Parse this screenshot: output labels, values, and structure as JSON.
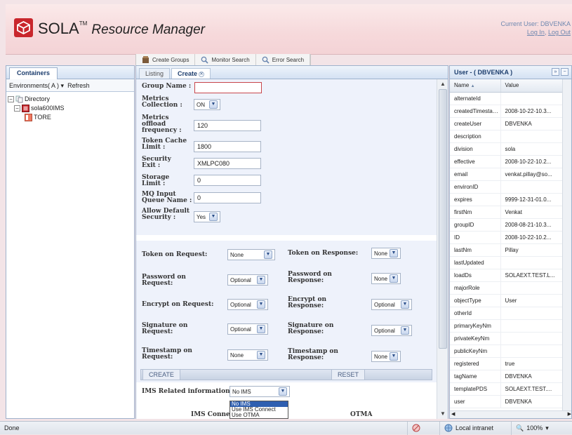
{
  "header": {
    "brand": "SOLA",
    "trademark": "TM",
    "subtitle": "Resource Manager",
    "current_user": "Current User: DBVENKA",
    "login_link": "Log In",
    "logout_link": "Log Out",
    "links_separator": ","
  },
  "toolbar": {
    "create_groups": "Create Groups",
    "monitor_search": "Monitor Search",
    "error_search": "Error Search"
  },
  "containers": {
    "tab": "Containers",
    "environments": "Environments( A ) ",
    "environments_caret": "▾",
    "refresh": "Refresh",
    "tree": {
      "directory": "Directory",
      "server": "sola600IMS",
      "leaf": "TORE"
    }
  },
  "center": {
    "tab_listing": "Listing",
    "tab_create": "Create",
    "fields": {
      "group_name": {
        "label": "Group Name :",
        "value": ""
      },
      "metrics_collection": {
        "label": "Metrics Collection :",
        "value": "ON"
      },
      "metrics_offload": {
        "label": "Metrics offload frequency :",
        "value": "120"
      },
      "token_cache": {
        "label": "Token Cache Limit :",
        "value": "1800"
      },
      "security_exit": {
        "label": "Security Exit :",
        "value": "XMLPC080"
      },
      "storage_limit": {
        "label": "Storage Limit :",
        "value": "0"
      },
      "mq_input": {
        "label": "MQ Input Queue Name :",
        "value": "0"
      },
      "allow_default": {
        "label": "Allow Default Security :",
        "value": "Yes"
      }
    },
    "security": {
      "token_request": {
        "label": "Token on Request:",
        "value": "None"
      },
      "token_response": {
        "label": "Token on Response:",
        "value": "None"
      },
      "password_request": {
        "label": "Password on Request:",
        "value": "Optional"
      },
      "password_response": {
        "label": "Password on Response:",
        "value": "None"
      },
      "encrypt_request": {
        "label": "Encrypt on Request:",
        "value": "Optional"
      },
      "encrypt_response": {
        "label": "Encrypt on Response:",
        "value": "Optional"
      },
      "signature_request": {
        "label": "Signature on Request:",
        "value": "Optional"
      },
      "signature_response": {
        "label": "Signature on Response:",
        "value": "Optional"
      },
      "timestamp_request": {
        "label": "Timestamp on Request:",
        "value": "None"
      },
      "timestamp_response": {
        "label": "Timestamp on Response:",
        "value": "None"
      }
    },
    "create_button": "CREATE",
    "reset_button": "RESET",
    "ims": {
      "label": "IMS Related information",
      "value": "No IMS",
      "options": [
        "No IMS",
        "Use IMS Connect",
        "Use OTMA"
      ],
      "selected_option": "No IMS",
      "col_connect": "IMS Conne",
      "col_otma": "OTMA"
    }
  },
  "user_panel": {
    "title": "User - ( DBVENKA )",
    "col_name": "Name",
    "col_name_sort": "▲",
    "col_value": "Value",
    "rows": [
      {
        "name": "alternateId",
        "value": ""
      },
      {
        "name": "createdTimestamp",
        "value": "2008-10-22-10.3..."
      },
      {
        "name": "createUser",
        "value": "DBVENKA"
      },
      {
        "name": "description",
        "value": ""
      },
      {
        "name": "division",
        "value": "sola"
      },
      {
        "name": "effective",
        "value": "2008-10-22-10.2..."
      },
      {
        "name": "email",
        "value": "venkat.pillay@so..."
      },
      {
        "name": "environID",
        "value": ""
      },
      {
        "name": "expires",
        "value": "9999-12-31-01.0..."
      },
      {
        "name": "firstNm",
        "value": "Venkat"
      },
      {
        "name": "groupID",
        "value": "2008-08-21-10.3..."
      },
      {
        "name": "ID",
        "value": "2008-10-22-10.2..."
      },
      {
        "name": "lastNm",
        "value": "Pillay"
      },
      {
        "name": "lastUpdated",
        "value": ""
      },
      {
        "name": "loadDs",
        "value": "SOLAEXT.TEST.L..."
      },
      {
        "name": "majorRole",
        "value": ""
      },
      {
        "name": "objectType",
        "value": "User"
      },
      {
        "name": "otherId",
        "value": ""
      },
      {
        "name": "primaryKeyNm",
        "value": ""
      },
      {
        "name": "privateKeyNm",
        "value": ""
      },
      {
        "name": "publicKeyNm",
        "value": ""
      },
      {
        "name": "registered",
        "value": "true"
      },
      {
        "name": "tagName",
        "value": "DBVENKA"
      },
      {
        "name": "templatePDS",
        "value": "SOLAEXT.TEST...."
      },
      {
        "name": "user",
        "value": "DBVENKA"
      }
    ]
  },
  "status": {
    "left": "Done",
    "zone": "Local intranet",
    "zoom": "100%"
  },
  "colors": {
    "brand_red": "#c9262c",
    "banner_pink": "#f6d9db",
    "link_blue": "#6f88b0",
    "panel_border": "#9eb2cc",
    "selected_blue": "#2f5fb0"
  }
}
